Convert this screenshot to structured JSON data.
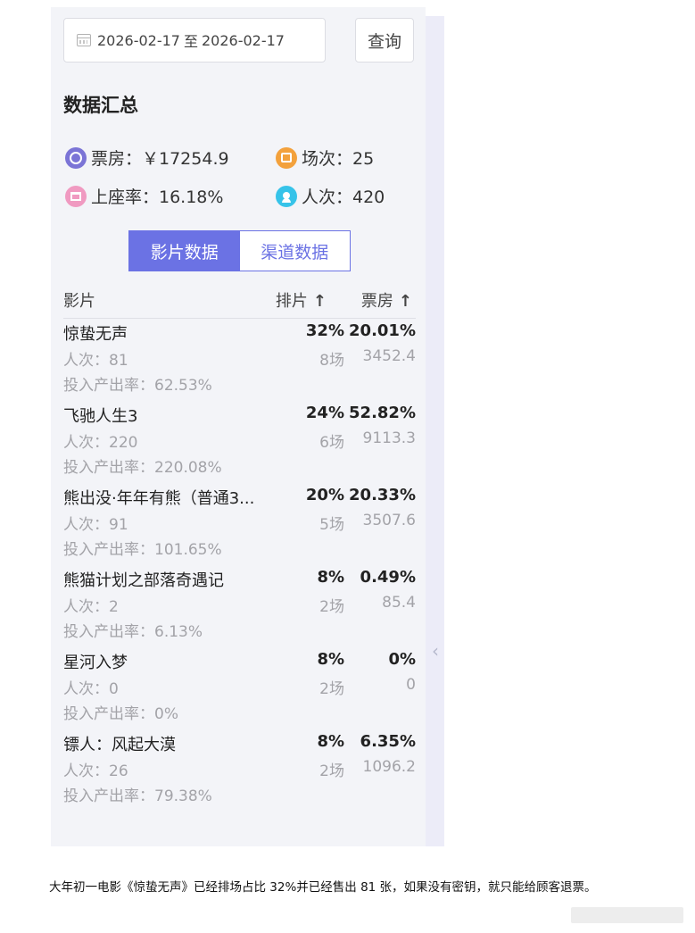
{
  "filter": {
    "date_start": "2026-02-17",
    "date_sep": "至",
    "date_end": "2026-02-17",
    "query_label": "查询",
    "icon": "calendar-icon"
  },
  "summary": {
    "title": "数据汇总",
    "box_office": "票房：￥17254.9",
    "sessions": "场次：25",
    "occupancy": "上座率：16.18%",
    "attendance": "人次：420",
    "icons": {
      "box_office": "film-reel-icon",
      "sessions": "calendar-session-icon",
      "occupancy": "seat-icon",
      "attendance": "person-icon"
    },
    "colors": {
      "box_office": "#7b74d6",
      "sessions": "#f3a13c",
      "occupancy": "#f09ac1",
      "attendance": "#36c3e9"
    }
  },
  "tabs": [
    {
      "label": "影片数据",
      "active": true
    },
    {
      "label": "渠道数据",
      "active": false
    }
  ],
  "accent_color": "#6b72e4",
  "table": {
    "col_film": "影片",
    "col_schedule": "排片",
    "col_boxoffice": "票房",
    "sort_icon": "arrow-up-icon",
    "rows": [
      {
        "title": "惊蛰无声",
        "schedule_pct": "32%",
        "box_pct": "20.01%",
        "attendance": "人次：81",
        "sessions": "8场",
        "box_value": "3452.4",
        "roi": "投入产出率：62.53%"
      },
      {
        "title": "飞驰人生3",
        "schedule_pct": "24%",
        "box_pct": "52.82%",
        "attendance": "人次：220",
        "sessions": "6场",
        "box_value": "9113.3",
        "roi": "投入产出率：220.08%"
      },
      {
        "title": "熊出没·年年有熊（普通3...",
        "schedule_pct": "20%",
        "box_pct": "20.33%",
        "attendance": "人次：91",
        "sessions": "5场",
        "box_value": "3507.6",
        "roi": "投入产出率：101.65%"
      },
      {
        "title": "熊猫计划之部落奇遇记",
        "schedule_pct": "8%",
        "box_pct": "0.49%",
        "attendance": "人次：2",
        "sessions": "2场",
        "box_value": "85.4",
        "roi": "投入产出率：6.13%"
      },
      {
        "title": "星河入梦",
        "schedule_pct": "8%",
        "box_pct": "0%",
        "attendance": "人次：0",
        "sessions": "2场",
        "box_value": "0",
        "roi": "投入产出率：0%"
      },
      {
        "title": "镖人：风起大漠",
        "schedule_pct": "8%",
        "box_pct": "6.35%",
        "attendance": "人次：26",
        "sessions": "2场",
        "box_value": "1096.2",
        "roi": "投入产出率：79.38%"
      }
    ]
  },
  "caption": "大年初一电影《惊蛰无声》已经排场占比 32%并已经售出 81 张，如果没有密钥，就只能给顾客退票。"
}
